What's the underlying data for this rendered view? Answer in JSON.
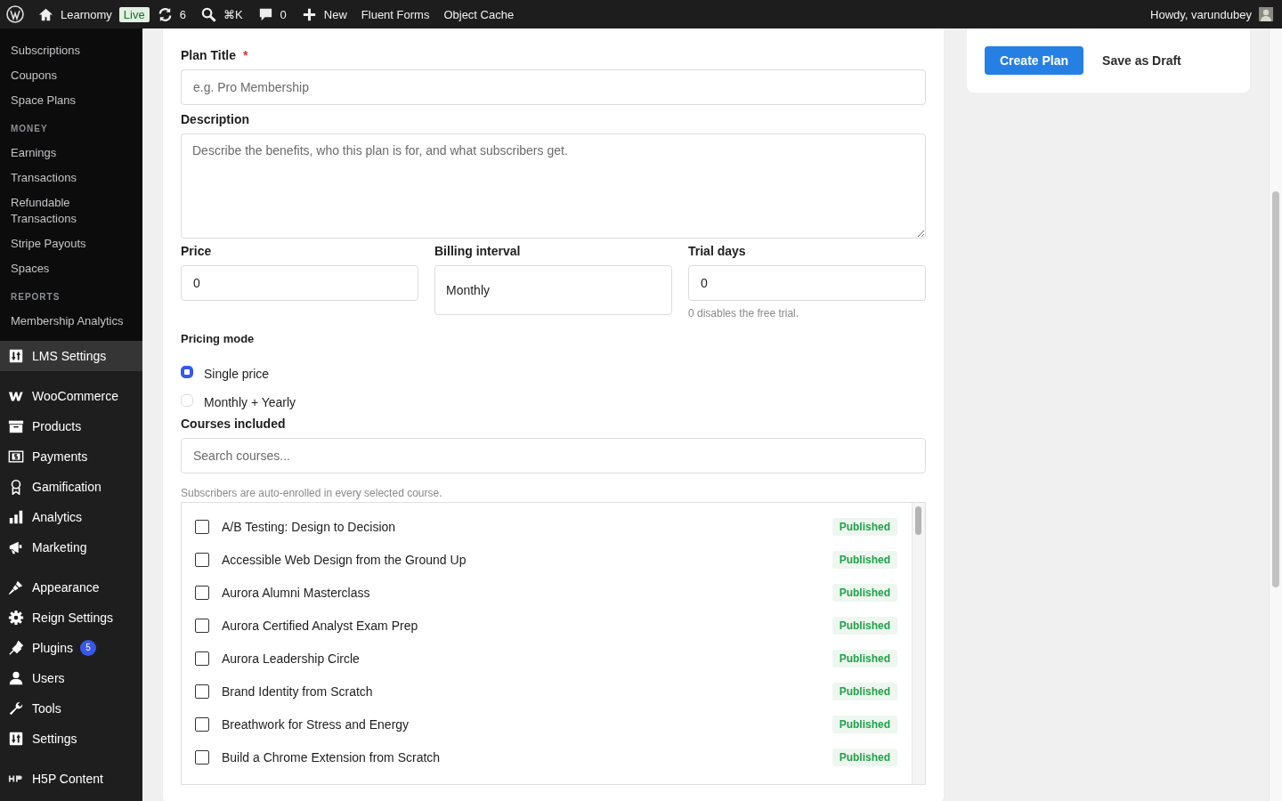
{
  "admin_bar": {
    "site": "Learnomy",
    "live_badge": "Live",
    "updates": "6",
    "search_shortcut": "⌘K",
    "comments": "0",
    "new": "New",
    "links": [
      "Fluent Forms",
      "Object Cache"
    ],
    "greeting": "Howdy, varundubey"
  },
  "sidebar": {
    "submenu": [
      {
        "kind": "item",
        "label": "Subscriptions"
      },
      {
        "kind": "item",
        "label": "Coupons"
      },
      {
        "kind": "item",
        "label": "Space Plans"
      },
      {
        "kind": "heading",
        "label": "MONEY"
      },
      {
        "kind": "item",
        "label": "Earnings"
      },
      {
        "kind": "item",
        "label": "Transactions"
      },
      {
        "kind": "item",
        "label": "Refundable Transactions"
      },
      {
        "kind": "item",
        "label": "Stripe Payouts"
      },
      {
        "kind": "item",
        "label": "Spaces"
      },
      {
        "kind": "heading",
        "label": "REPORTS"
      },
      {
        "kind": "item",
        "label": "Membership Analytics"
      }
    ],
    "menu": [
      {
        "label": "LMS Settings",
        "selected": true,
        "separated": false
      },
      {
        "label": "WooCommerce",
        "selected": false,
        "separated": true
      },
      {
        "label": "Products",
        "selected": false,
        "separated": false
      },
      {
        "label": "Payments",
        "selected": false,
        "separated": false
      },
      {
        "label": "Gamification",
        "selected": false,
        "separated": false
      },
      {
        "label": "Analytics",
        "selected": false,
        "separated": false
      },
      {
        "label": "Marketing",
        "selected": false,
        "separated": false
      },
      {
        "label": "Appearance",
        "selected": false,
        "separated": true
      },
      {
        "label": "Reign Settings",
        "selected": false,
        "separated": false
      },
      {
        "label": "Plugins",
        "selected": false,
        "separated": false,
        "badge": "5"
      },
      {
        "label": "Users",
        "selected": false,
        "separated": false
      },
      {
        "label": "Tools",
        "selected": false,
        "separated": false
      },
      {
        "label": "Settings",
        "selected": false,
        "separated": false
      },
      {
        "label": "H5P Content",
        "selected": false,
        "separated": true
      }
    ]
  },
  "form": {
    "plan_title": {
      "label": "Plan Title",
      "required_mark": "*",
      "placeholder": "e.g. Pro Membership"
    },
    "description": {
      "label": "Description",
      "placeholder": "Describe the benefits, who this plan is for, and what subscribers get."
    },
    "price": {
      "label": "Price",
      "value": "0"
    },
    "billing_interval": {
      "label": "Billing interval",
      "value": "Monthly"
    },
    "trial_days": {
      "label": "Trial days",
      "value": "0",
      "help": "0 disables the free trial."
    },
    "pricing_mode": {
      "label": "Pricing mode",
      "options": [
        {
          "label": "Single price",
          "selected": true
        },
        {
          "label": "Monthly + Yearly",
          "selected": false
        }
      ]
    },
    "courses": {
      "label": "Courses included",
      "placeholder": "Search courses...",
      "help": "Subscribers are auto-enrolled in every selected course.",
      "items": [
        {
          "title": "A/B Testing: Design to Decision",
          "status": "Published",
          "checked": false
        },
        {
          "title": "Accessible Web Design from the Ground Up",
          "status": "Published",
          "checked": false
        },
        {
          "title": "Aurora Alumni Masterclass",
          "status": "Published",
          "checked": false
        },
        {
          "title": "Aurora Certified Analyst Exam Prep",
          "status": "Published",
          "checked": false
        },
        {
          "title": "Aurora Leadership Circle",
          "status": "Published",
          "checked": false
        },
        {
          "title": "Brand Identity from Scratch",
          "status": "Published",
          "checked": false
        },
        {
          "title": "Breathwork for Stress and Energy",
          "status": "Published",
          "checked": false
        },
        {
          "title": "Build a Chrome Extension from Scratch",
          "status": "Published",
          "checked": false
        }
      ]
    }
  },
  "actions": {
    "primary": "Create Plan",
    "secondary": "Save as Draft"
  }
}
